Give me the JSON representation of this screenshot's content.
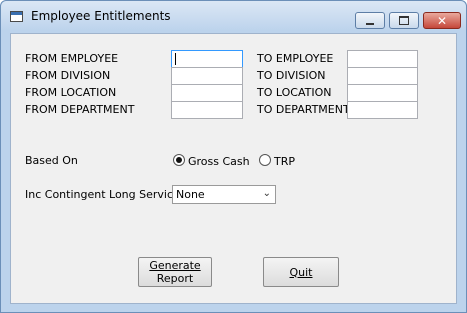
{
  "window": {
    "title": "Employee Entitlements",
    "close_glyph": "✕"
  },
  "filters": {
    "from_employee": {
      "label": "FROM EMPLOYEE",
      "value": ""
    },
    "from_division": {
      "label": "FROM DIVISION",
      "value": ""
    },
    "from_location": {
      "label": "FROM LOCATION",
      "value": ""
    },
    "from_department": {
      "label": "FROM DEPARTMENT",
      "value": ""
    },
    "to_employee": {
      "label": "TO EMPLOYEE",
      "value": ""
    },
    "to_division": {
      "label": "TO DIVISION",
      "value": ""
    },
    "to_location": {
      "label": "TO LOCATION",
      "value": ""
    },
    "to_department": {
      "label": "TO DEPARTMENT",
      "value": ""
    }
  },
  "based_on": {
    "label": "Based On",
    "options": [
      {
        "label": "Gross Cash",
        "selected": true
      },
      {
        "label": "TRP",
        "selected": false
      }
    ]
  },
  "contingent": {
    "label": "Inc Contingent Long Service",
    "selected": "None",
    "icon": "chevron-down-icon"
  },
  "buttons": {
    "generate_line1": "Generate",
    "generate_line2": "Report",
    "quit": "Quit"
  }
}
